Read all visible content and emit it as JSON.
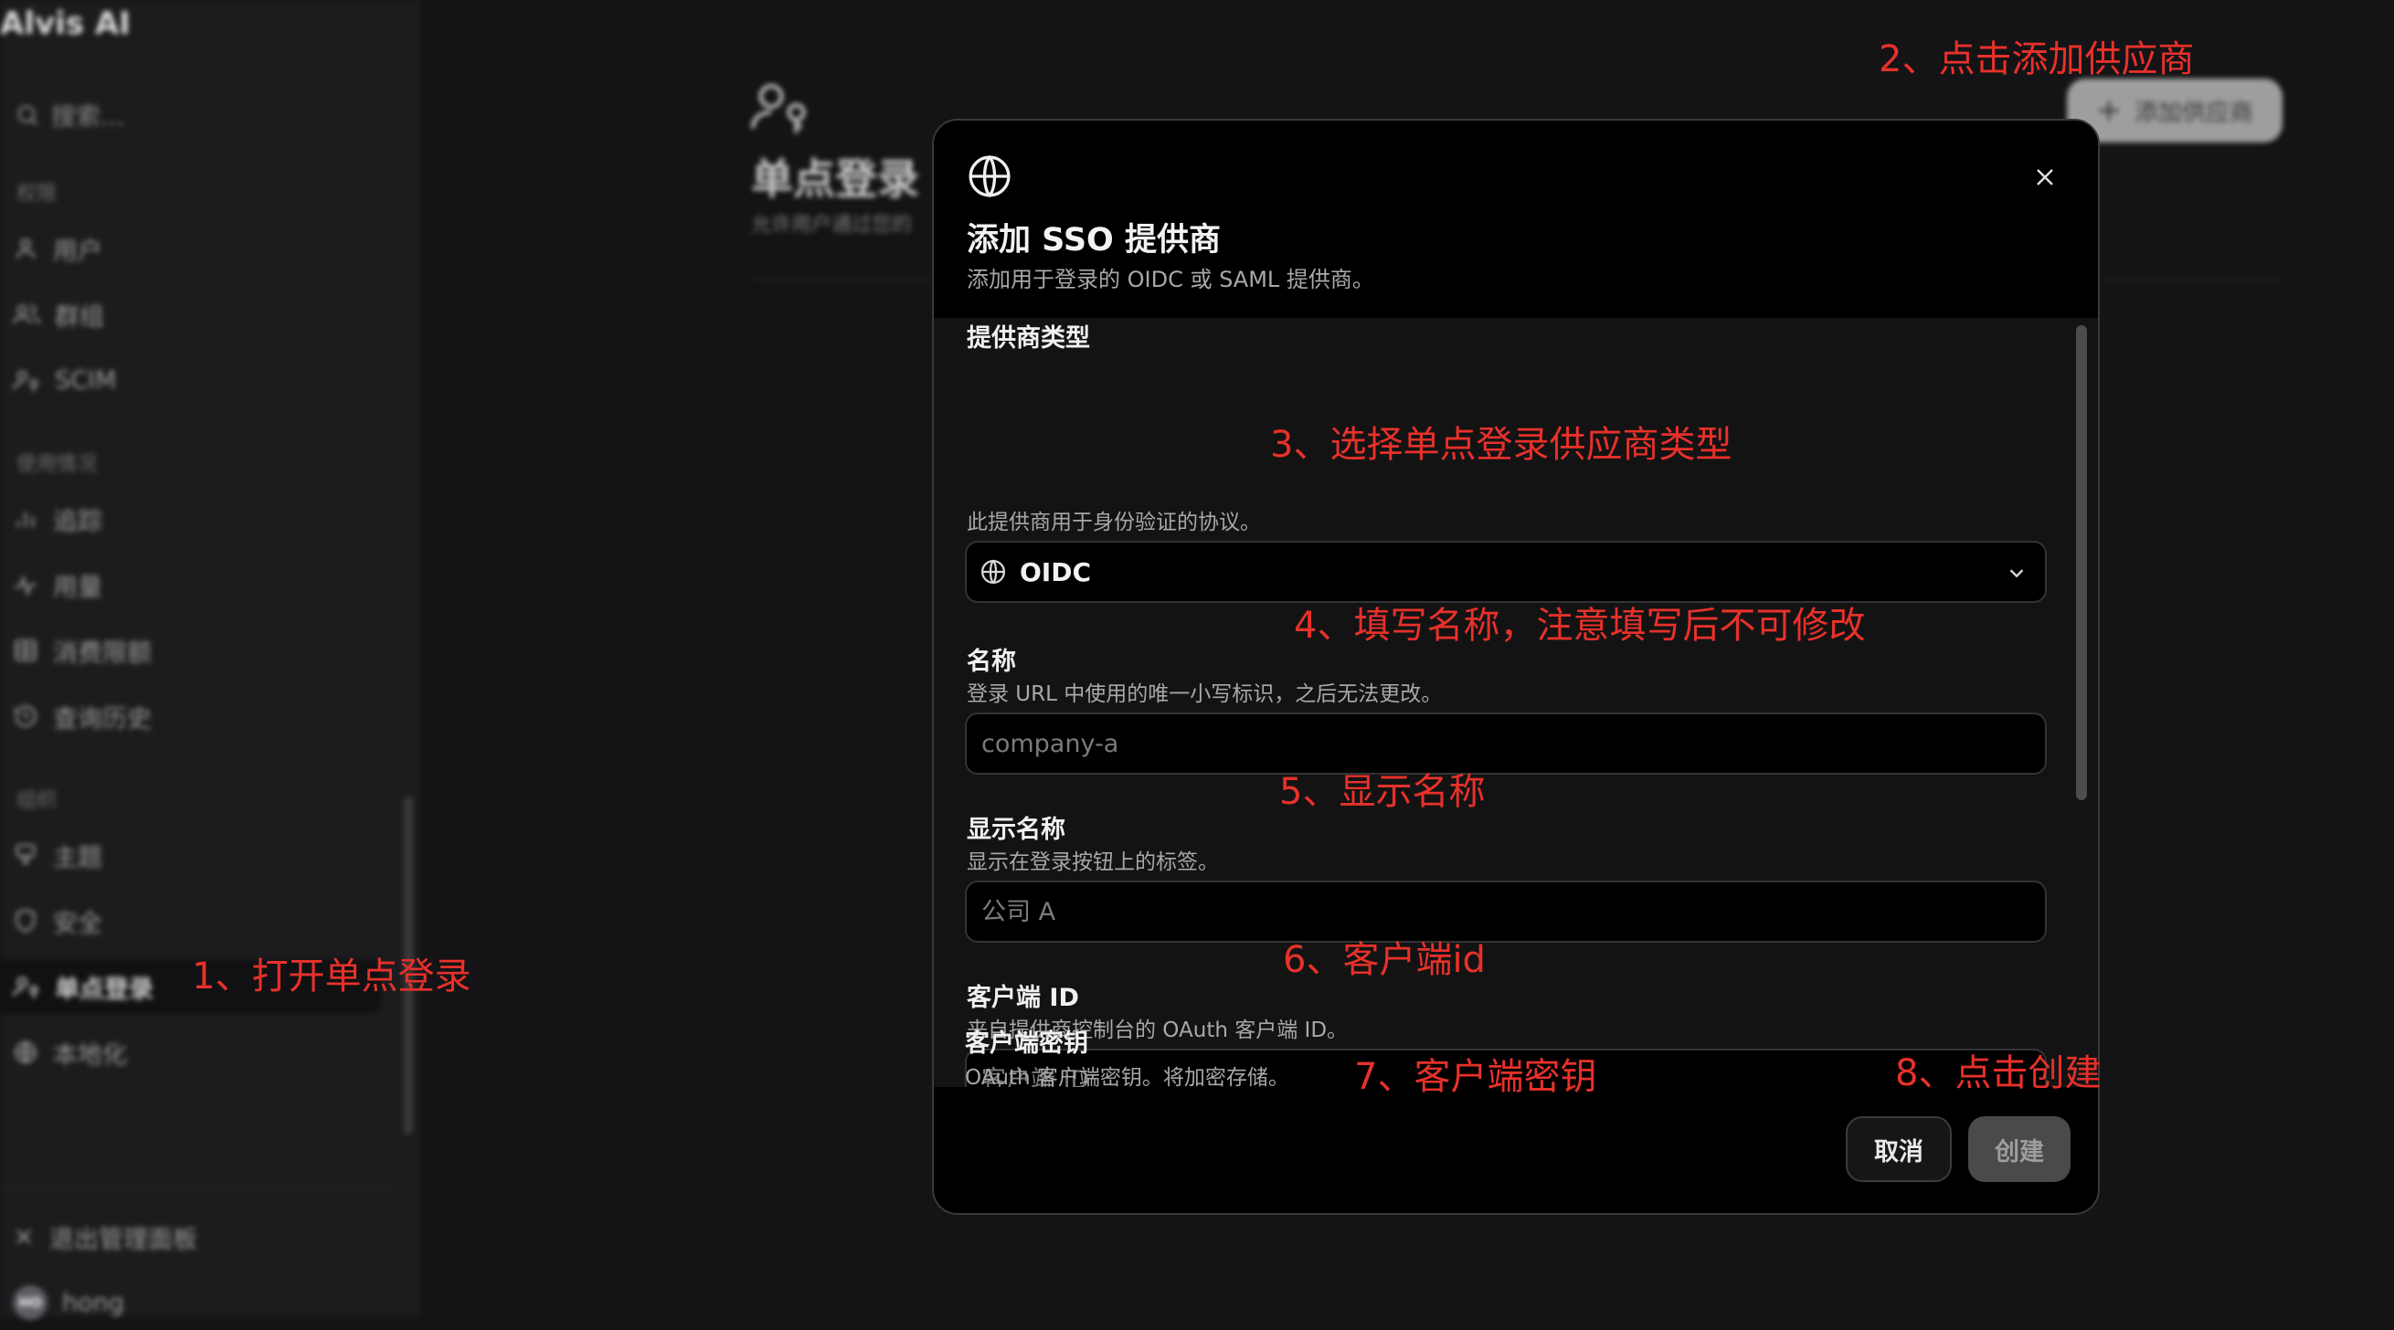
{
  "sidebar": {
    "app_title": "Alvis AI",
    "search_placeholder": "搜索...",
    "sections": {
      "permissions": "权限",
      "usage": "使用情况",
      "organization": "组织"
    },
    "items": [
      {
        "label": "用户",
        "icon": "user-icon"
      },
      {
        "label": "群组",
        "icon": "users-icon"
      },
      {
        "label": "SCIM",
        "icon": "user-key-icon"
      },
      {
        "label": "追踪",
        "icon": "bar-chart-icon"
      },
      {
        "label": "用量",
        "icon": "activity-icon"
      },
      {
        "label": "消费限额",
        "icon": "grid-icon"
      },
      {
        "label": "查询历史",
        "icon": "history-icon"
      },
      {
        "label": "主题",
        "icon": "brush-icon"
      },
      {
        "label": "安全",
        "icon": "shield-icon"
      },
      {
        "label": "单点登录",
        "icon": "user-key-icon",
        "active": true
      },
      {
        "label": "本地化",
        "icon": "globe-icon"
      }
    ],
    "exit_label": "退出管理面板",
    "user": {
      "name": "hong",
      "initials": "HO"
    }
  },
  "page": {
    "title": "单点登录",
    "subtitle": "允许用户通过您的",
    "add_provider_label": "添加供应商"
  },
  "modal": {
    "title": "添加 SSO 提供商",
    "description": "添加用于登录的 OIDC 或 SAML 提供商。",
    "fields": {
      "provider_type": {
        "label": "提供商类型",
        "help": "此提供商用于身份验证的协议。",
        "value": "OIDC"
      },
      "name": {
        "label": "名称",
        "help": "登录 URL 中使用的唯一小写标识，之后无法更改。",
        "placeholder": "company-a"
      },
      "display_name": {
        "label": "显示名称",
        "help": "显示在登录按钮上的标签。",
        "placeholder": "公司 A"
      },
      "client_id": {
        "label": "客户端 ID",
        "help": "来自提供商控制台的 OAuth 客户端 ID。",
        "placeholder": "客户端 ID"
      },
      "client_secret": {
        "label": "客户端密钥",
        "help": "OAuth 客户端密钥。将加密存储。"
      }
    },
    "cancel_label": "取消",
    "create_label": "创建"
  },
  "annotations": {
    "step1": "1、打开单点登录",
    "step2": "2、点击添加供应商",
    "step3": "3、选择单点登录供应商类型",
    "step4": "4、填写名称，注意填写后不可修改",
    "step5": "5、显示名称",
    "step6": "6、客户端id",
    "step7": "7、客户端密钥",
    "step8": "8、点击创建"
  },
  "colors": {
    "annotation": "#e8312a",
    "modal_bg": "#000000",
    "modal_body_bg": "#131314",
    "sidebar_bg": "#1c1c1e"
  }
}
